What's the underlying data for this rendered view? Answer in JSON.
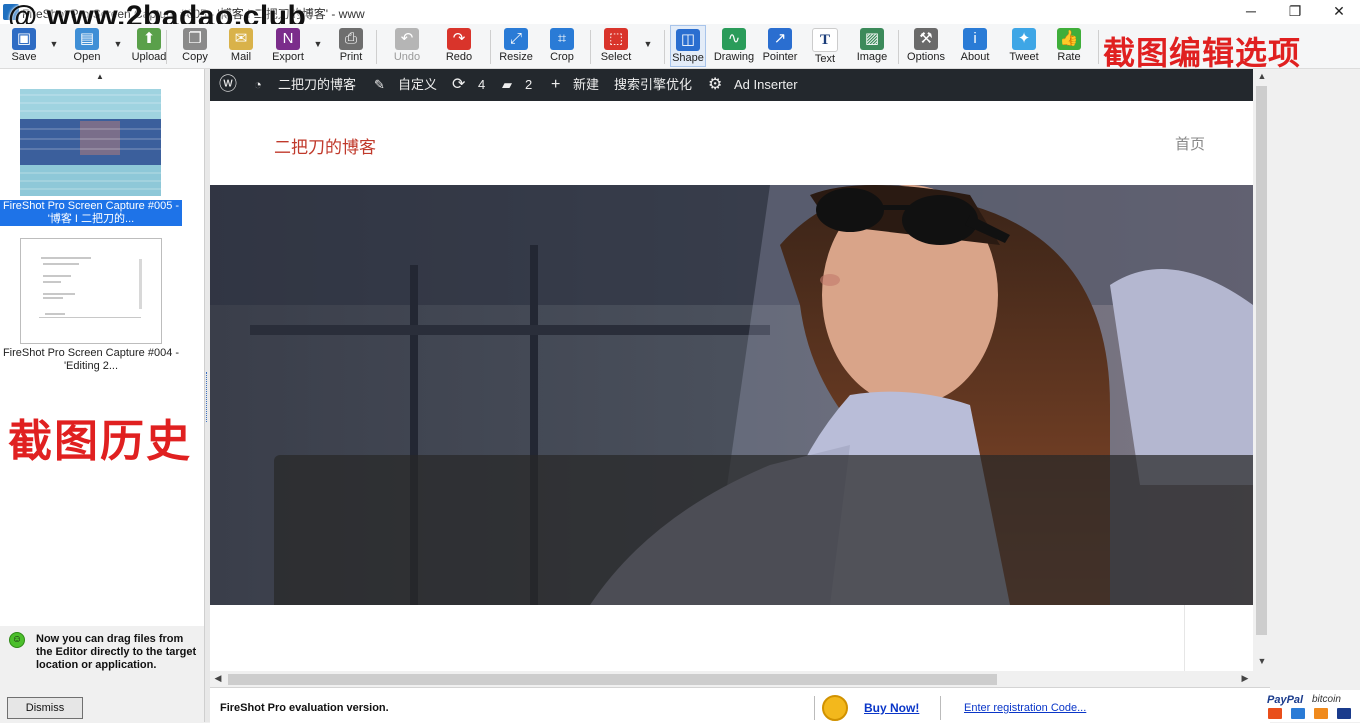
{
  "window": {
    "title": "FireShot Pro Screen Capture #005 - '博客 I 二把刀的博客' - www",
    "watermark": "@ www.2badao.club",
    "controls": {
      "minimize": "─",
      "maximize": "❐",
      "close": "✕"
    }
  },
  "toolbar": {
    "items": [
      {
        "label": "Save",
        "icon": "floppy-icon",
        "color": "#2e6cc4"
      },
      {
        "label": "Open",
        "icon": "open-icon",
        "color": "#3f8fd6"
      },
      {
        "label": "Upload",
        "icon": "upload-icon",
        "color": "#5aa04a"
      },
      {
        "label": "Copy",
        "icon": "copy-icon",
        "color": "#8a8a8a"
      },
      {
        "label": "Mail",
        "icon": "mail-icon",
        "color": "#d9b24a"
      },
      {
        "label": "Export",
        "icon": "onenote-icon",
        "color": "#7b2d8b"
      },
      {
        "label": "Print",
        "icon": "printer-icon",
        "color": "#6e6e6e"
      },
      {
        "label": "Undo",
        "icon": "undo-icon",
        "color": "#b5b5b5"
      },
      {
        "label": "Redo",
        "icon": "redo-icon",
        "color": "#d9342b"
      },
      {
        "label": "Resize",
        "icon": "resize-icon",
        "color": "#2a7bd6"
      },
      {
        "label": "Crop",
        "icon": "crop-icon",
        "color": "#2a7bd6"
      },
      {
        "label": "Select",
        "icon": "select-icon",
        "color": "#d9342b"
      },
      {
        "label": "Shape",
        "icon": "shape-icon",
        "color": "#2a6ed0"
      },
      {
        "label": "Drawing",
        "icon": "drawing-icon",
        "color": "#2a9c5a"
      },
      {
        "label": "Pointer",
        "icon": "pointer-icon",
        "color": "#2a6ed0"
      },
      {
        "label": "Text",
        "icon": "text-icon",
        "color": "#1b3d7a"
      },
      {
        "label": "Image",
        "icon": "image-icon",
        "color": "#3c8a5a"
      },
      {
        "label": "Options",
        "icon": "tools-icon",
        "color": "#6a6a6a"
      },
      {
        "label": "About",
        "icon": "info-icon",
        "color": "#2a7bd6"
      },
      {
        "label": "Tweet",
        "icon": "twitter-icon",
        "color": "#3ea6e6"
      },
      {
        "label": "Rate",
        "icon": "thumbs-up-icon",
        "color": "#3fae3a"
      }
    ],
    "annotation": "截图编辑选项"
  },
  "history": {
    "items": [
      {
        "caption": "FireShot Pro Screen Capture #005 - '博客 I 二把刀的...",
        "selected": true
      },
      {
        "caption": "FireShot Pro Screen Capture #004 - 'Editing 2...",
        "selected": false
      }
    ],
    "annotation": "截图历史"
  },
  "tip": {
    "text": "Now you can drag files from the Editor directly to the target location or application.",
    "dismiss": "Dismiss"
  },
  "page": {
    "adminbar": {
      "site": "二把刀的博客",
      "customize": "自定义",
      "updates": "4",
      "comments": "2",
      "new": "新建",
      "seo": "搜索引擎优化",
      "ad": "Ad Inserter"
    },
    "site_title": "二把刀的博客",
    "home": "首页"
  },
  "bottom": {
    "eval": "FireShot Pro evaluation version.",
    "buy": "Buy Now!",
    "register": "Enter registration Code...",
    "paypal": "PayPal",
    "bitcoin": "bitcoin"
  },
  "colors": {
    "accent_red": "#e02020",
    "selection": "#1e73e8",
    "wpbar": "#23282d"
  }
}
